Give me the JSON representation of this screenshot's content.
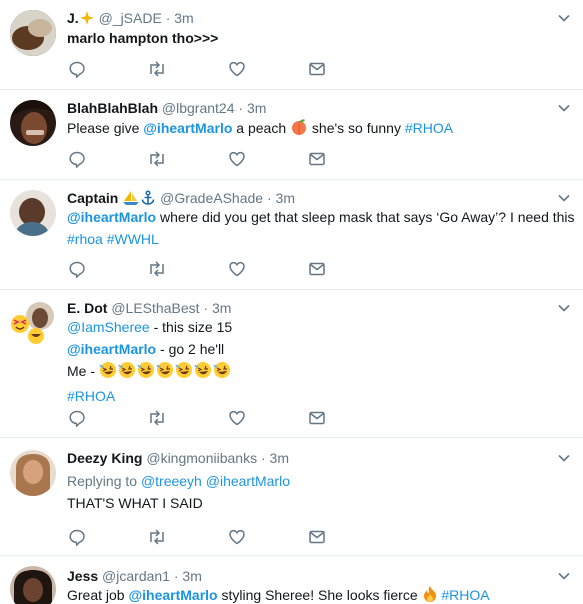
{
  "tweets": [
    {
      "name": "J.",
      "handle": "@_jSADE",
      "time": "3m",
      "text": "marlo hampton tho>>>"
    },
    {
      "name": "BlahBlahBlah",
      "handle": "@lbgrant24",
      "time": "3m",
      "pre": "Please give ",
      "mention": "@iheartMarlo",
      "mid": " a peach ",
      "post": " she's so funny ",
      "hashtag": "#RHOA"
    },
    {
      "name": "Captain",
      "handle": "@GradeAShade",
      "time": "3m",
      "mention": "@iheartMarlo",
      "text": " where did you get that sleep mask that says ‘Go Away’? I need this",
      "hashtags": "#rhoa #WWHL"
    },
    {
      "name": "E. Dot",
      "handle": "@LESthaBest",
      "time": "3m",
      "line1_mention": "@IamSheree",
      "line1_text": " - this size 15",
      "line2_mention": "@iheartMarlo",
      "line2_text": " - go 2 he'll",
      "line3_text": "Me - ",
      "hashtag": "#RHOA"
    },
    {
      "name": "Deezy",
      "name_bold2": "King",
      "handle": "@kingmoniibanks",
      "time": "3m",
      "reply_label": "Replying to ",
      "reply_1": "@treeeyh",
      "reply_2": "@iheartMarlo",
      "text": "THAT'S WHAT I SAID"
    },
    {
      "name": "Jess",
      "handle": "@jcardan1",
      "time": "3m",
      "pre": "Great job ",
      "mention": "@iheartMarlo",
      "text": " styling Sheree! She looks fierce ",
      "hashtag": "#RHOA"
    }
  ],
  "separator": "·",
  "colors": {
    "link": "#1b95e0",
    "muted": "#657786",
    "divider": "#e6ecf0"
  }
}
